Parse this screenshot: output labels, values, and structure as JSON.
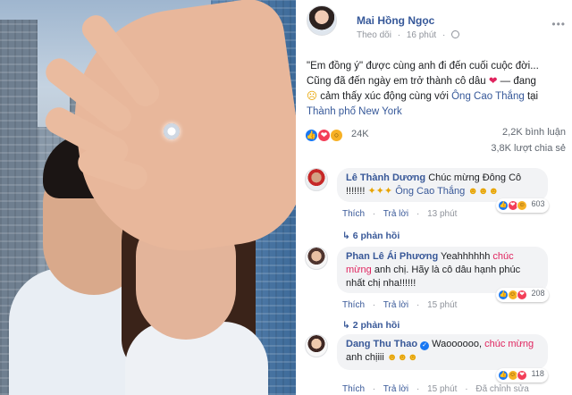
{
  "post": {
    "author": "Mai Hồng Ngọc",
    "follow_label": "Theo dõi",
    "dot": "·",
    "time": "16 phút",
    "text_line1": "\"Em đồng ý\" được cùng anh đi đến cuối cuộc đời...",
    "text_line2": "Cũng đã đến ngày em trở thành cô dâu",
    "text_feeling": "— đang",
    "text_feeling2": "cảm thấy xúc động cùng với",
    "tag_person": "Ông Cao Thắng",
    "tag_at": "tại",
    "tag_place": "Thành phố New York",
    "reactions_count": "24K",
    "comments_count": "2,2K bình luận",
    "shares_count": "3,8K lượt chia sẻ"
  },
  "comments": [
    {
      "name": "Lê Thành Dương",
      "text": "Chúc mừng Đông Cô !!!!!!!",
      "tag": "Ông Cao Thắng",
      "reactions": "603",
      "like": "Thích",
      "reply": "Trả lời",
      "time": "13 phút",
      "replies": "6 phản hồi"
    },
    {
      "name": "Phan Lê Ái Phương",
      "text_a": "Yeahhhhhh",
      "highlight": "chúc mừng",
      "text_b": "anh chị. Hãy là cô dâu hạnh phúc nhất chị nha!!!!!!",
      "reactions": "208",
      "like": "Thích",
      "reply": "Trả lời",
      "time": "15 phút",
      "replies": "2 phản hồi"
    },
    {
      "name": "Dang Thu Thao",
      "text_a": "Waoooooo,",
      "highlight": "chúc mừng",
      "text_b": "anh chịiii",
      "reactions": "118",
      "like": "Thích",
      "reply": "Trả lời",
      "time": "15 phút",
      "edited": "Đã chỉnh sửa"
    }
  ],
  "colors": {
    "link": "#365899",
    "like": "#1877f2",
    "love": "#f33e58",
    "highlight": "#e0245e"
  },
  "icons": {
    "globe": "globe-icon",
    "more": "more-icon",
    "like": "like-reaction-icon",
    "love": "love-reaction-icon",
    "wow": "wow-reaction-icon",
    "reply_arrow": "reply-arrow-icon",
    "verified": "verified-badge-icon"
  }
}
